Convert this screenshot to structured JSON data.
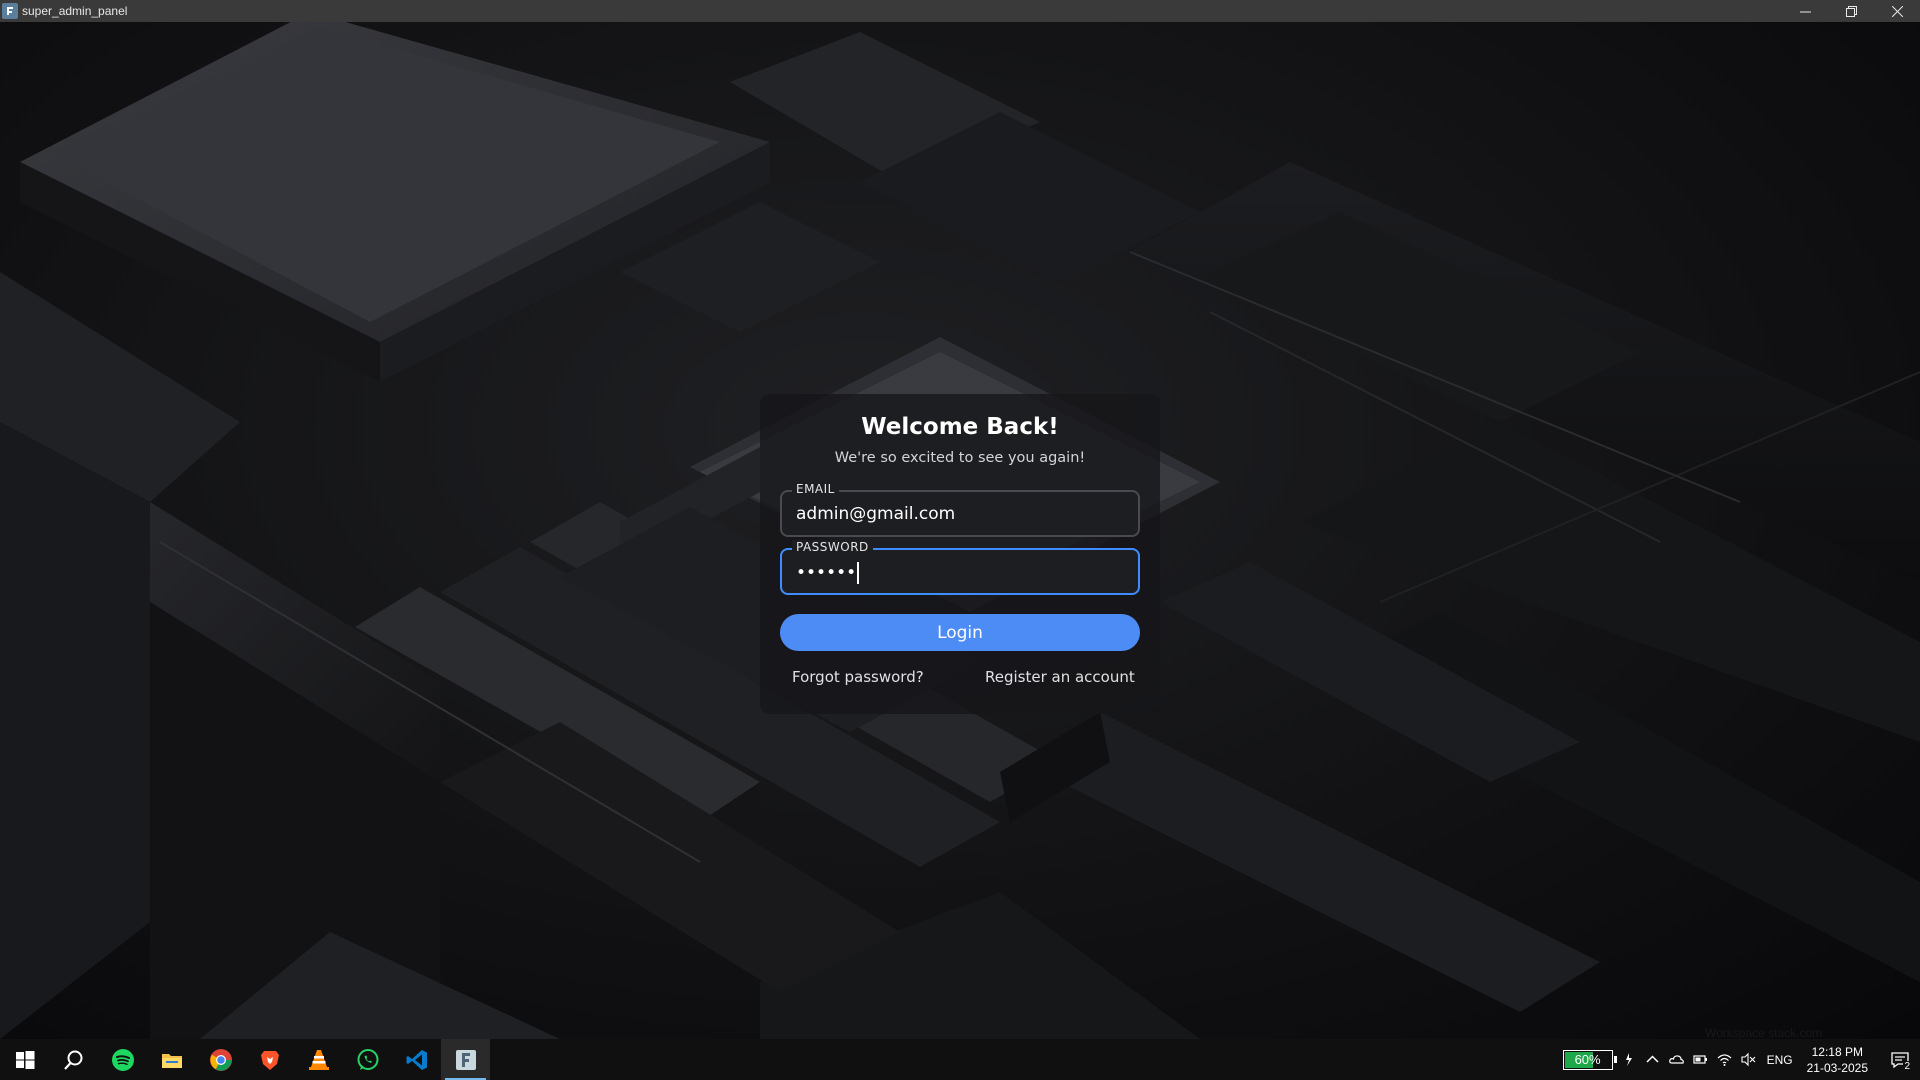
{
  "window": {
    "title": "super_admin_panel"
  },
  "login": {
    "title": "Welcome Back!",
    "subtitle": "We're so excited to see you again!",
    "email_label": "EMAIL",
    "email_value": "admin@gmail.com",
    "password_label": "PASSWORD",
    "password_value": "••••••",
    "login_button": "Login",
    "forgot_link": "Forgot password?",
    "register_link": "Register an account"
  },
  "watermark": "Workspace stack.com",
  "taskbar": {
    "apps": [
      "start-icon",
      "search-icon",
      "spotify-icon",
      "file-explorer-icon",
      "chrome-icon",
      "brave-icon",
      "vlc-icon",
      "whatsapp-icon",
      "vscode-icon",
      "super-admin-panel-icon"
    ],
    "battery": "60%",
    "language": "ENG",
    "time": "12:18 PM",
    "date": "21-03-2025",
    "notification_count": "2"
  },
  "colors": {
    "accent": "#4e8cf5",
    "focus_border": "#3f8cff",
    "battery_fill": "#1fa84a"
  }
}
